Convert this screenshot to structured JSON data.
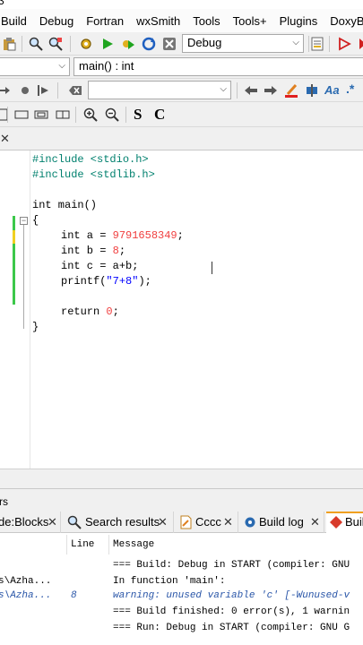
{
  "title_fragment": "3",
  "menubar": [
    "Build",
    "Debug",
    "Fortran",
    "wxSmith",
    "Tools",
    "Tools+",
    "Plugins",
    "DoxyBlocks"
  ],
  "toolbar": {
    "build_target": "Debug",
    "function_scope": "main() : int",
    "search_value": "",
    "bold_label": "S",
    "c_label": "C",
    "aa_label": "Aa",
    "regex_label": ".*"
  },
  "editor": {
    "lines": [
      {
        "kind": "pp",
        "text": "#include <stdio.h>"
      },
      {
        "kind": "pp",
        "text": "#include <stdlib.h>"
      },
      {
        "kind": "blank",
        "text": ""
      },
      {
        "kind": "decl",
        "text": "int main()"
      },
      {
        "kind": "brace",
        "text": "{"
      },
      {
        "kind": "blank",
        "text": ""
      },
      {
        "kind": "var",
        "type": "int",
        "name": " a = ",
        "value": "9791658349",
        "tail": ";"
      },
      {
        "kind": "var",
        "type": "int",
        "name": " b = ",
        "value": "8",
        "tail": ";"
      },
      {
        "kind": "plain",
        "type": "int",
        "text": " c = a+b;"
      },
      {
        "kind": "printf",
        "fn": "printf(",
        "str": "\"7+8\"",
        "tail": ");"
      },
      {
        "kind": "blank",
        "text": ""
      },
      {
        "kind": "ret",
        "kw": "return",
        "value": " 0",
        "tail": ";"
      },
      {
        "kind": "brace",
        "text": "}"
      }
    ]
  },
  "panel": {
    "title": "rs",
    "tabs": [
      "de:Blocks",
      "Search results",
      "Cccc",
      "Build log",
      "Build"
    ],
    "columns": [
      "Line",
      "Message"
    ],
    "rows": [
      {
        "file": "",
        "line": "",
        "message": "=== Build: Debug in START (compiler: GNU",
        "style": "normal"
      },
      {
        "file": "s\\Azha...",
        "line": "",
        "message": "In function 'main':",
        "style": "normal"
      },
      {
        "file": "s\\Azha...",
        "line": "8",
        "message": "warning: unused variable 'c' [-Wunused-v",
        "style": "warn"
      },
      {
        "file": "",
        "line": "",
        "message": "=== Build finished: 0 error(s), 1 warnin",
        "style": "normal"
      },
      {
        "file": "",
        "line": "",
        "message": "=== Run: Debug in START (compiler: GNU G",
        "style": "normal"
      }
    ]
  },
  "colors": {
    "accent": "#f0a020",
    "preprocessor": "#00806e",
    "keyword": "#00008b",
    "number": "#f03e3e",
    "string": "#0000ff",
    "warning": "#2a56a8",
    "changed_bar": "#3cc84a",
    "modified_bar": "#f0d020"
  }
}
